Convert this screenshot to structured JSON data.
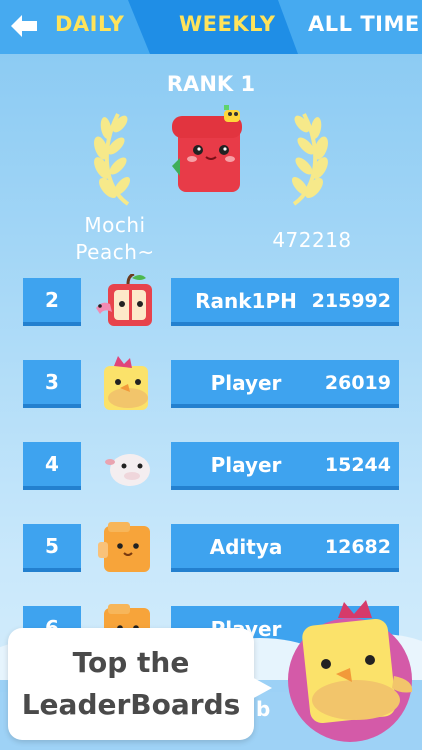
{
  "tabs": {
    "daily": "DAILY",
    "weekly": "WEEKLY",
    "all_time": "ALL TIME"
  },
  "rank1": {
    "title": "RANK 1",
    "name_line1": "Mochi",
    "name_line2": "Peach~",
    "score": "472218"
  },
  "rows": [
    {
      "rank": "2",
      "name": "Rank1PH",
      "score": "215992",
      "avatar": "apple-worm-avatar"
    },
    {
      "rank": "3",
      "name": "Player",
      "score": "26019",
      "avatar": "yellow-chick-avatar"
    },
    {
      "rank": "4",
      "name": "Player",
      "score": "15244",
      "avatar": "white-sheep-avatar"
    },
    {
      "rank": "5",
      "name": "Aditya",
      "score": "12682",
      "avatar": "orange-block-avatar"
    },
    {
      "rank": "6",
      "name": "Player",
      "score": "",
      "avatar": "orange-block-avatar"
    }
  ],
  "callout": {
    "line1": "Top the",
    "line2": "LeaderBoards",
    "overlap_text": "b"
  },
  "colors": {
    "tab_bar": "#46aaf0",
    "tab_active": "#1f8ee6",
    "tab_highlight_text": "#ffe35a",
    "row_fill": "#3ea3ef",
    "row_shadow": "#2380cf",
    "laurel": "#f6e98a"
  }
}
